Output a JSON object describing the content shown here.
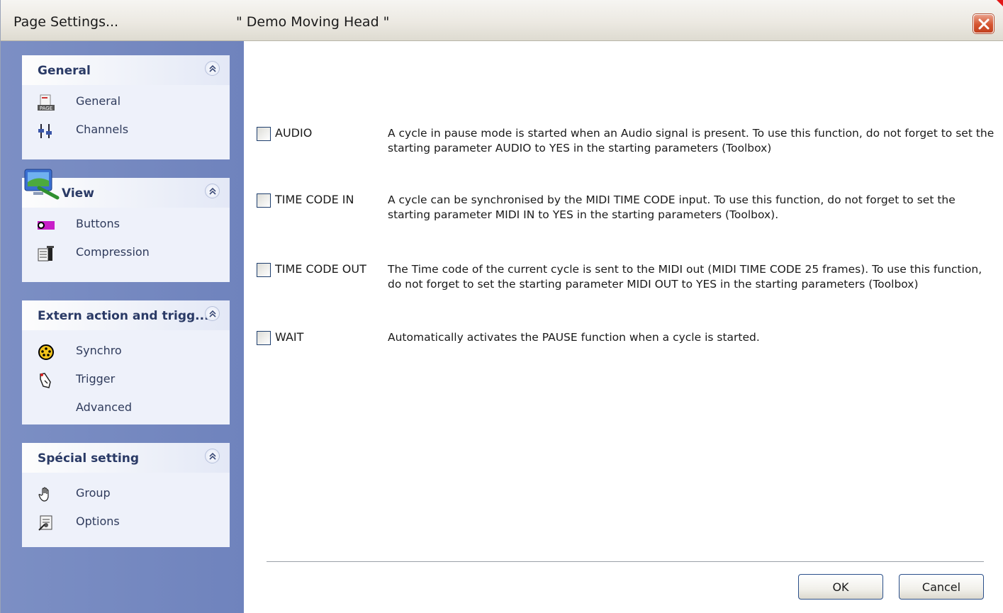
{
  "window": {
    "title": "Page  Settings...",
    "document": "\" Demo Moving Head \""
  },
  "sidebar": {
    "groups": [
      {
        "title": "General",
        "items": [
          {
            "label": "General",
            "icon": "page-icon"
          },
          {
            "label": "Channels",
            "icon": "channels-icon"
          }
        ]
      },
      {
        "title": "View",
        "items": [
          {
            "label": "Buttons",
            "icon": "buttons-icon"
          },
          {
            "label": "Compression",
            "icon": "compression-icon"
          }
        ]
      },
      {
        "title": "Extern action and trigg...",
        "items": [
          {
            "label": "Synchro",
            "icon": "synchro-icon"
          },
          {
            "label": "Trigger",
            "icon": "trigger-icon"
          },
          {
            "label": "Advanced",
            "icon": ""
          }
        ]
      },
      {
        "title": "Spécial setting",
        "items": [
          {
            "label": "Group",
            "icon": "hand-icon"
          },
          {
            "label": "Options",
            "icon": "options-icon"
          }
        ]
      }
    ]
  },
  "options": [
    {
      "label": "AUDIO",
      "checked": false,
      "description": "A cycle in pause mode is started when an Audio signal is present. To use this function, do not forget to set the starting parameter AUDIO to YES in the starting parameters (Toolbox)"
    },
    {
      "label": "TIME CODE IN",
      "checked": false,
      "description": "A cycle can be synchronised by the MIDI TIME CODE input. To use this function, do not forget to set the starting parameter MIDI IN to YES in the starting parameters (Toolbox)."
    },
    {
      "label": "TIME CODE OUT",
      "checked": false,
      "description": "The Time code of the current cycle is sent to the MIDI out (MIDI TIME CODE 25 frames).  To use this function, do not forget to set the starting parameter MIDI OUT to YES in the starting parameters (Toolbox)"
    },
    {
      "label": "WAIT",
      "checked": false,
      "description": "Automatically activates the PAUSE function when a cycle is started."
    }
  ],
  "buttons": {
    "ok": "OK",
    "cancel": "Cancel"
  },
  "colors": {
    "sidebar": "#7084bf",
    "title_bar": "#ece9e2",
    "close": "#d5542f",
    "button_border": "#2a4f8a"
  }
}
